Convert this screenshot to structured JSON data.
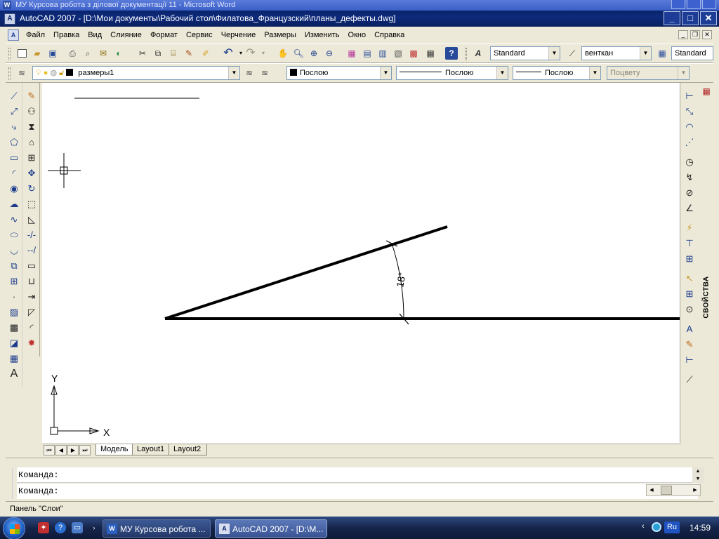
{
  "background_window": {
    "title": "МУ  Курсова робота з ділової документації 11 - Microsoft Word"
  },
  "window": {
    "app_title": "AutoCAD 2007 - [D:\\Мои документы\\Рабочий стол\\Филатова_Французский\\планы_дефекты.dwg]",
    "minimize": "_",
    "maximize": "□",
    "close": "✕"
  },
  "menu": {
    "items": [
      "Файл",
      "Правка",
      "Вид",
      "Слияние",
      "Формат",
      "Сервис",
      "Черчение",
      "Размеры",
      "Изменить",
      "Окно",
      "Справка"
    ]
  },
  "toolbar": {
    "text_style": "Standard",
    "dim_style": "венткан",
    "table_style": "Standard"
  },
  "layers": {
    "current_layer": "размеры1",
    "color": "Послою",
    "linetype": "Послою",
    "lineweight": "Послою",
    "plotstyle": "Поцвету"
  },
  "drawing": {
    "angle_label": "18°",
    "ucs_x": "X",
    "ucs_y": "Y"
  },
  "properties_palette": {
    "label": "СВОЙСТВА"
  },
  "layout_tabs": {
    "items": [
      "Модель",
      "Layout1",
      "Layout2"
    ],
    "active": "Модель"
  },
  "command": {
    "line1": "Команда:",
    "line2": "Команда:"
  },
  "status": {
    "text": "Панель \"Слои\""
  },
  "taskbar": {
    "tasks": [
      "МУ  Курсова робота ...",
      "AutoCAD 2007 - [D:\\М..."
    ],
    "language": "Ru",
    "clock": "14:59"
  },
  "colors": {
    "title_bar": "#0a246a",
    "chrome": "#ece9d8",
    "canvas": "#ffffff"
  }
}
